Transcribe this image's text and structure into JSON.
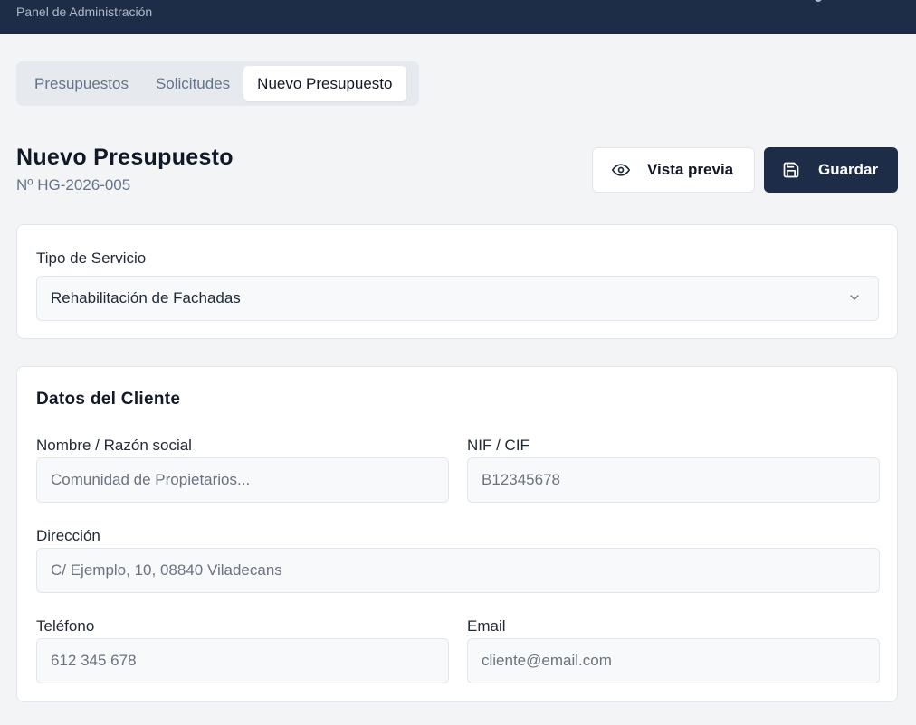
{
  "header": {
    "subtitle": "Panel de Administración"
  },
  "tabs": [
    {
      "label": "Presupuestos",
      "active": false
    },
    {
      "label": "Solicitudes",
      "active": false
    },
    {
      "label": "Nuevo Presupuesto",
      "active": true
    }
  ],
  "page": {
    "title": "Nuevo Presupuesto",
    "number": "Nº HG-2026-005"
  },
  "actions": {
    "preview_label": "Vista previa",
    "save_label": "Guardar"
  },
  "service": {
    "label": "Tipo de Servicio",
    "selected": "Rehabilitación de Fachadas"
  },
  "client": {
    "section_title": "Datos del Cliente",
    "name": {
      "label": "Nombre / Razón social",
      "placeholder": "Comunidad de Propietarios..."
    },
    "nif": {
      "label": "NIF / CIF",
      "placeholder": "B12345678"
    },
    "address": {
      "label": "Dirección",
      "placeholder": "C/ Ejemplo, 10, 08840 Viladecans"
    },
    "phone": {
      "label": "Teléfono",
      "placeholder": "612 345 678"
    },
    "email": {
      "label": "Email",
      "placeholder": "cliente@email.com"
    }
  },
  "colors": {
    "header_bg": "#1e2d47",
    "primary_button": "#1e2d47",
    "page_bg": "#f3f4f6"
  }
}
